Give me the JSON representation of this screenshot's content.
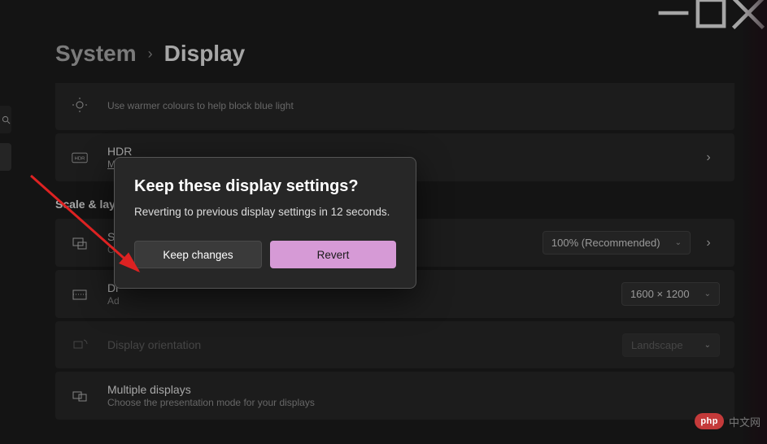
{
  "breadcrumb": {
    "root": "System",
    "leaf": "Display"
  },
  "cards": {
    "nightlight_sub": "Use warmer colours to help block blue light",
    "hdr_title": "HDR",
    "hdr_link": "More about HDR",
    "scale_partial_title": "Sc",
    "scale_partial_sub": "C",
    "scale_value": "100% (Recommended)",
    "res_partial_title": "Di",
    "res_partial_sub": "Ad",
    "res_value": "1600 × 1200",
    "orient_title": "Display orientation",
    "orient_value": "Landscape",
    "multi_title": "Multiple displays",
    "multi_sub": "Choose the presentation mode for your displays"
  },
  "group_head": "Scale & layo",
  "dialog": {
    "title": "Keep these display settings?",
    "body": "Reverting to previous display settings in 12 seconds.",
    "keep": "Keep changes",
    "revert": "Revert"
  },
  "watermark": {
    "badge": "php",
    "text": "中文网"
  }
}
